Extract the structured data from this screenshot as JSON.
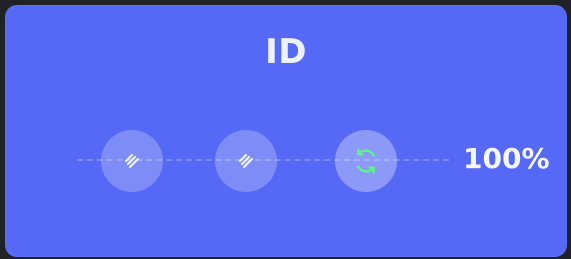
{
  "card": {
    "title": "ID",
    "progress_text": "100%"
  },
  "icons": {
    "step1": "signal-icon",
    "step2": "signal-icon",
    "step3": "refresh-icon"
  },
  "colors": {
    "card": "#5669f6",
    "refresh": "#61f08d",
    "text": "#eef2ff"
  }
}
